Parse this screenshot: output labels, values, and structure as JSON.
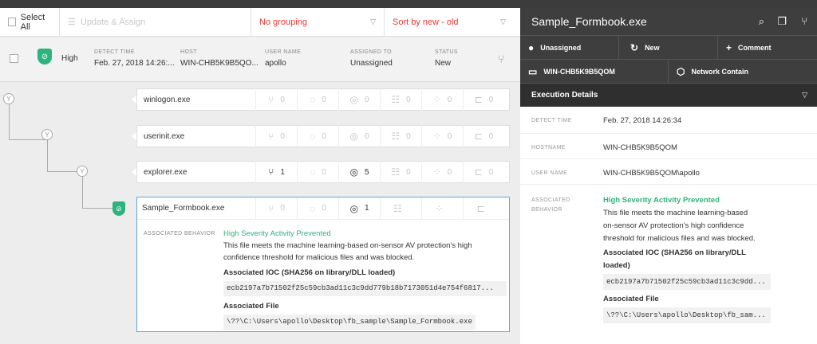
{
  "toolbar": {
    "select_all": "Select All",
    "update_assign": "Update & Assign",
    "grouping": "No grouping",
    "sort": "Sort by new - old"
  },
  "detection": {
    "severity": "High",
    "detect_time_label": "DETECT TIME",
    "detect_time": "Feb. 27, 2018 14:26:...",
    "host_label": "HOST",
    "host": "WIN-CHB5K9B5QO...",
    "user_label": "USER NAME",
    "user": "apollo",
    "assigned_label": "ASSIGNED TO",
    "assigned": "Unassigned",
    "status_label": "STATUS",
    "status": "New"
  },
  "processes": [
    {
      "name": "winlogon.exe",
      "stats": [
        "0",
        "0",
        "0",
        "0",
        "0",
        "0"
      ]
    },
    {
      "name": "userinit.exe",
      "stats": [
        "0",
        "0",
        "0",
        "0",
        "0",
        "0"
      ]
    },
    {
      "name": "explorer.exe",
      "stats": [
        "1",
        "0",
        "5",
        "0",
        "0",
        "0"
      ]
    },
    {
      "name": "Sample_Formbook.exe",
      "stats": [
        "0",
        "0",
        "1",
        "",
        "",
        ""
      ]
    }
  ],
  "behavior": {
    "label": "ASSOCIATED BEHAVIOR",
    "title": "High Severity Activity Prevented",
    "desc1": "This file meets the machine learning-based on-sensor AV protection's high",
    "desc2": "confidence threshold for malicious files and was blocked.",
    "ioc_title": "Associated IOC (SHA256 on library/DLL loaded)",
    "ioc": "ecb2197a7b71502f25c59cb3ad11c3c9dd779b18b7173051d4e754f6817...",
    "file_title": "Associated File",
    "file": "\\??\\C:\\Users\\apollo\\Desktop\\fb_sample\\Sample_Formbook.exe"
  },
  "panel": {
    "title": "Sample_Formbook.exe",
    "btn_unassigned": "Unassigned",
    "btn_new": "New",
    "btn_comment": "Comment",
    "btn_host": "WIN-CHB5K9B5QOM",
    "btn_contain": "Network Contain",
    "exec_details": "Execution Details",
    "detect_time_label": "DETECT TIME",
    "detect_time": "Feb. 27, 2018 14:26:34",
    "hostname_label": "HOSTNAME",
    "hostname": "WIN-CHB5K9B5QOM",
    "username_label": "USER NAME",
    "username": "WIN-CHB5K9B5QOM\\apollo",
    "assoc_label1": "ASSOCIATED",
    "assoc_label2": "BEHAVIOR",
    "beh_title": "High Severity Activity Prevented",
    "beh_l1": "This file meets the machine learning-based",
    "beh_l2": "on-sensor AV protection's high confidence",
    "beh_l3": "threshold for malicious files and was blocked.",
    "ioc_t1": "Associated IOC (SHA256 on library/DLL",
    "ioc_t2": "loaded)",
    "ioc": "ecb2197a7b71502f25c59cb3ad11c3c9dd...",
    "file_title": "Associated File",
    "file": "\\??\\C:\\Users\\apollo\\Desktop\\fb_sam..."
  },
  "colors": {
    "accent_red": "#e53935",
    "green": "#2db37d",
    "dark": "#3e3e3e"
  }
}
